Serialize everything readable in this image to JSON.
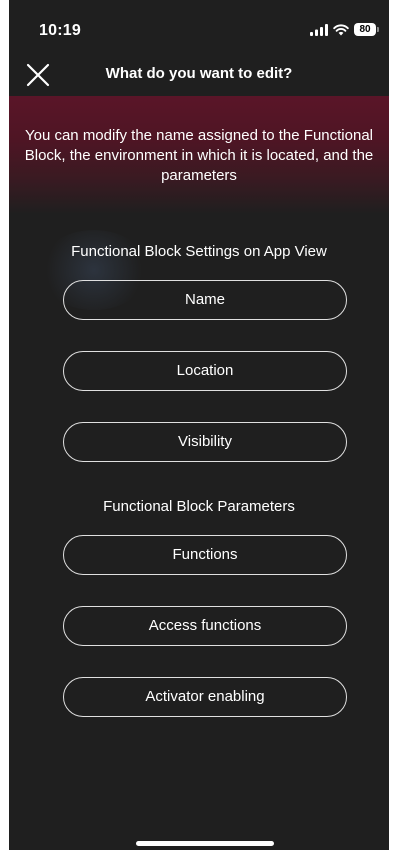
{
  "status_bar": {
    "time": "10:19",
    "battery": "80",
    "icons": [
      "signal-icon",
      "wifi-icon",
      "battery-icon"
    ]
  },
  "header": {
    "title": "What do you want to edit?",
    "close_icon": "close-icon"
  },
  "banner": {
    "text": "You can modify the name assigned to the Functional Block, the environment in which it is located, and the parameters"
  },
  "app_view_section": {
    "title": "Functional Block Settings on App View",
    "buttons": [
      {
        "label": "Name"
      },
      {
        "label": "Location"
      },
      {
        "label": "Visibility"
      }
    ]
  },
  "parameters_section": {
    "title": "Functional Block Parameters",
    "buttons": [
      {
        "label": "Functions"
      },
      {
        "label": "Access functions"
      },
      {
        "label": "Activator enabling"
      }
    ]
  },
  "colors": {
    "background": "#1f1f1f",
    "banner": "#5a1528",
    "button_border": "#e0e0e0",
    "text": "#ffffff"
  }
}
